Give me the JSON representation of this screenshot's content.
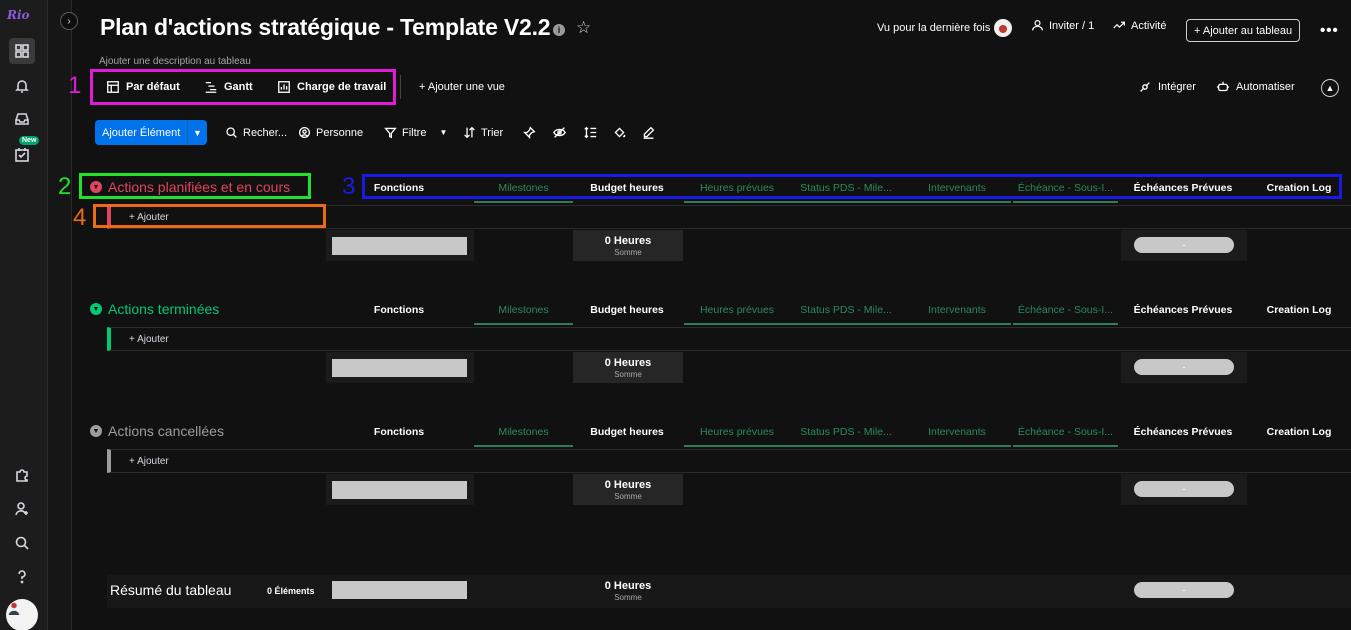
{
  "app": {
    "logo": "Rio"
  },
  "rail": {
    "new_badge": "New"
  },
  "board": {
    "title": "Plan d'actions stratégique - Template V2.2",
    "description": "Ajouter une description au tableau",
    "info_glyph": "i",
    "star_glyph": "☆"
  },
  "header": {
    "last_seen": "Vu pour la dernière fois",
    "invite": "Inviter / 1",
    "activity": "Activité",
    "add_to_board": "+ Ajouter au tableau",
    "more_glyph": "•••"
  },
  "views": {
    "items": [
      "Par défaut",
      "Gantt",
      "Charge de travail"
    ],
    "add_view": "+ Ajouter une vue",
    "integrate": "Intégrer",
    "automate": "Automatiser"
  },
  "annotations": [
    "1",
    "2",
    "3",
    "4"
  ],
  "toolbar": {
    "primary": "Ajouter Élément",
    "search": "Recher...",
    "person": "Personne",
    "filter": "Filtre",
    "sort": "Trier"
  },
  "columns": [
    "Fonctions",
    "Milestones",
    "Budget heures",
    "Heures prévues",
    "Status PDS - Mile...",
    "Intervenants",
    "Échéance - Sous-I...",
    "Échéances Prévues",
    "Creation Log"
  ],
  "groups": [
    {
      "name": "Actions planifiées et en cours",
      "color": "#e2445c",
      "add": "+ Ajouter",
      "hours": "0 Heures",
      "sum": "Somme",
      "pill": "-"
    },
    {
      "name": "Actions terminées",
      "color": "#00c875",
      "add": "+ Ajouter",
      "hours": "0 Heures",
      "sum": "Somme",
      "pill": "-"
    },
    {
      "name": "Actions cancellées",
      "color": "#9d9d9d",
      "add": "+ Ajouter",
      "hours": "0 Heures",
      "sum": "Somme",
      "pill": "-"
    }
  ],
  "summary": {
    "label": "Résumé du tableau",
    "count": "0 Éléments",
    "hours": "0 Heures",
    "sum": "Somme",
    "pill": "-"
  }
}
